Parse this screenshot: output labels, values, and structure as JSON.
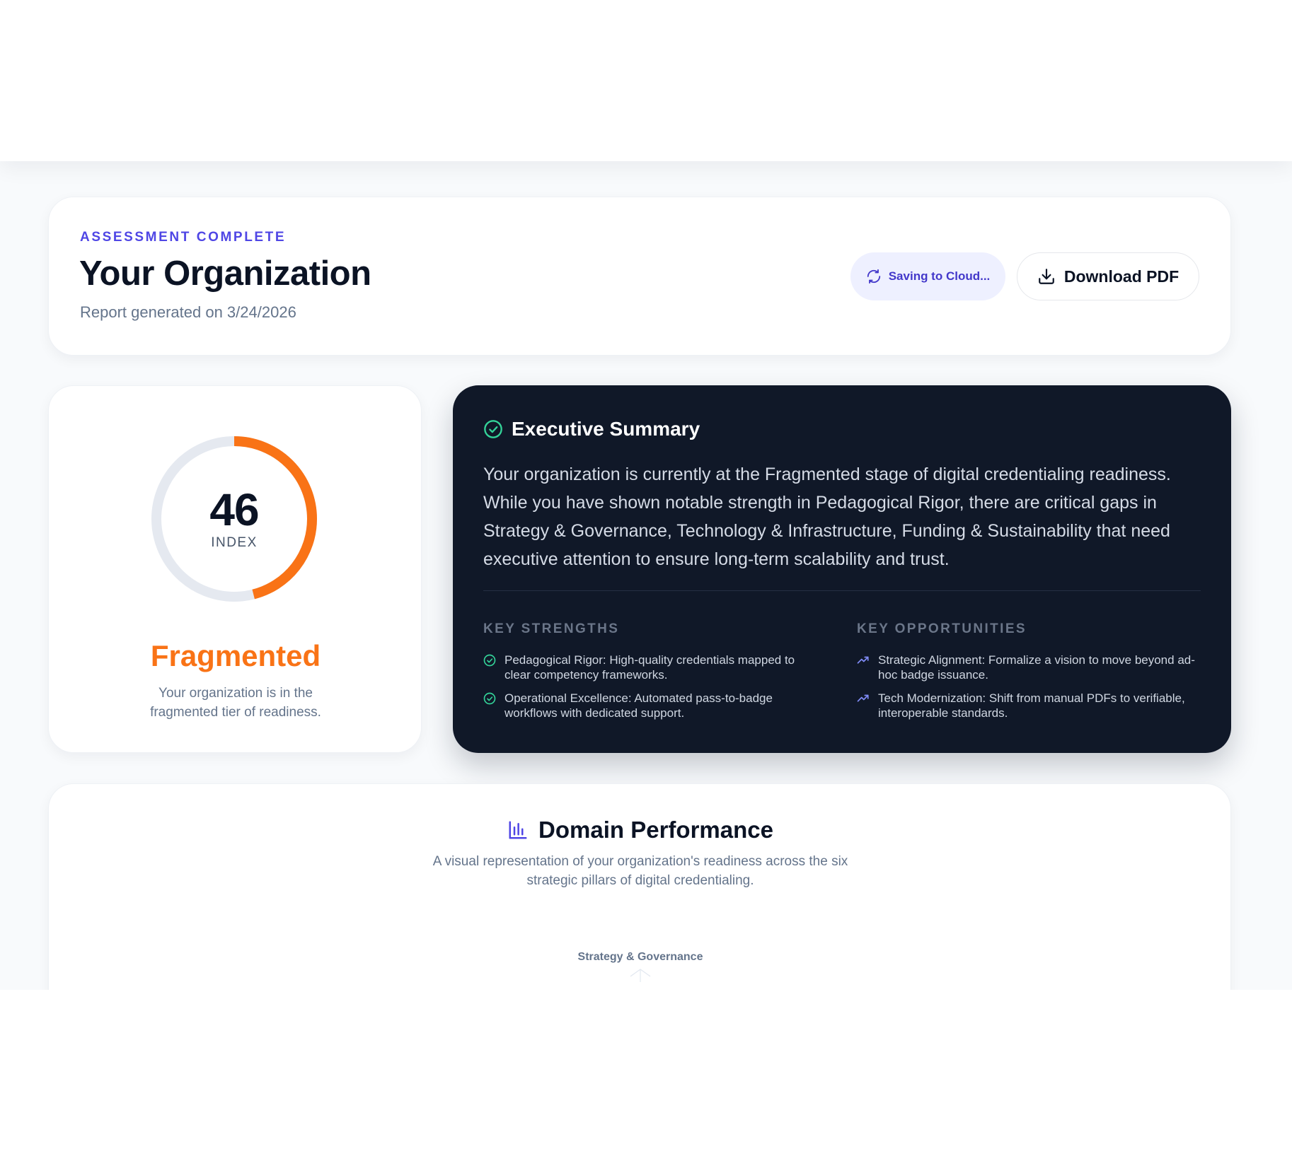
{
  "header": {
    "eyebrow": "ASSESSMENT COMPLETE",
    "title": "Your Organization",
    "generated": "Report generated on 3/24/2026",
    "saving_label": "Saving to Cloud...",
    "download_label": "Download PDF"
  },
  "score": {
    "value": "46",
    "value_fraction": 0.46,
    "label": "INDEX",
    "tier": "Fragmented",
    "tier_description": "Your organization is in the fragmented tier of readiness.",
    "accent_color": "#f97316",
    "track_color": "#e5e9f0"
  },
  "summary": {
    "title": "Executive Summary",
    "body": "Your organization is currently at the Fragmented stage of digital credentialing readiness. While you have shown notable strength in Pedagogical Rigor, there are critical gaps in Strategy & Governance, Technology & Infrastructure, Funding & Sustainability that need executive attention to ensure long-term scalability and trust.",
    "strengths_title": "KEY STRENGTHS",
    "strengths": [
      "Pedagogical Rigor: High-quality credentials mapped to clear competency frameworks.",
      "Operational Excellence: Automated pass-to-badge workflows with dedicated support."
    ],
    "opportunities_title": "KEY OPPORTUNITIES",
    "opportunities": [
      "Strategic Alignment: Formalize a vision to move beyond ad-hoc badge issuance.",
      "Tech Modernization: Shift from manual PDFs to verifiable, interoperable standards."
    ],
    "strength_icon": "check-circle-icon",
    "opportunity_icon": "trending-up-icon",
    "background_color": "#101828"
  },
  "domain": {
    "title": "Domain Performance",
    "subtitle": "A visual representation of your organization's readiness across the six strategic pillars of digital credentialing.",
    "first_axis_label": "Strategy & Governance",
    "icon": "bar-chart-icon"
  },
  "colors": {
    "brand": "#4f46e5",
    "accent": "#f97316",
    "success": "#22c55e"
  }
}
